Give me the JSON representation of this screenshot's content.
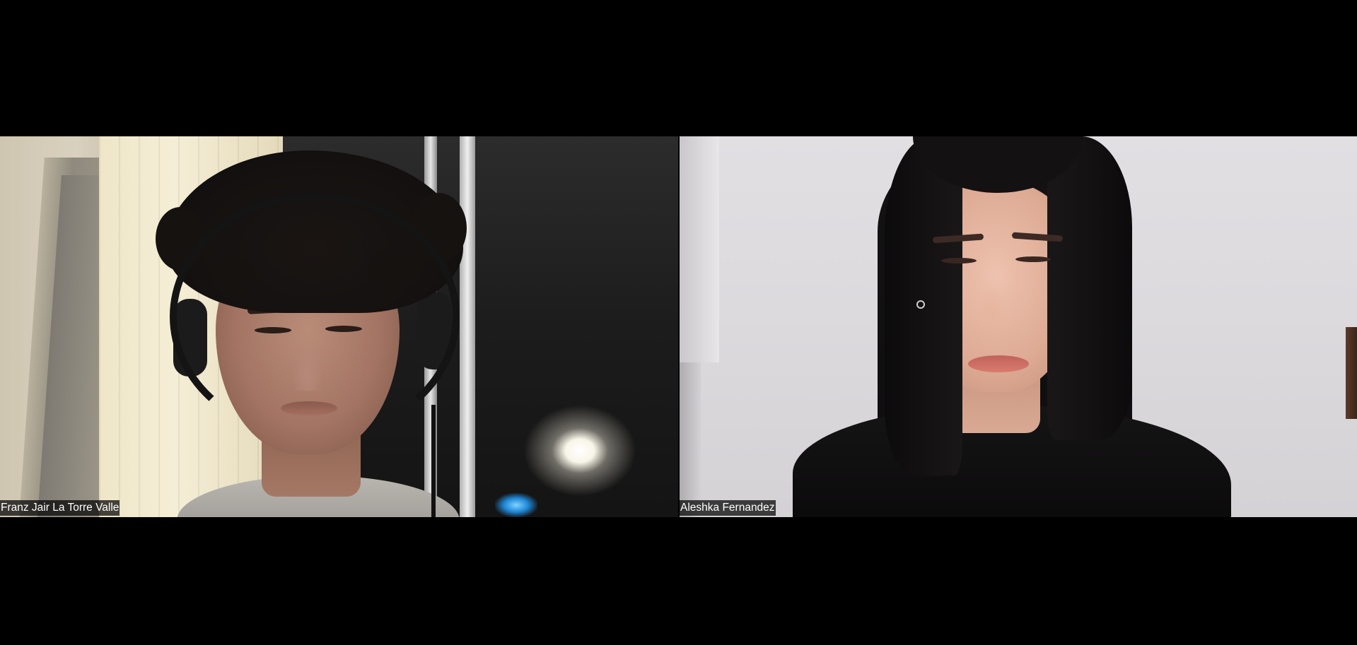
{
  "meeting": {
    "layout": "gallery-view",
    "background_color": "#000000"
  },
  "participants": [
    {
      "name": "Franz Jair La Torre Valle",
      "video": "on"
    },
    {
      "name": "Aleshka Fernandez",
      "video": "on"
    }
  ],
  "label_style": {
    "text_color": "#ffffff",
    "background_color": "#000000"
  }
}
